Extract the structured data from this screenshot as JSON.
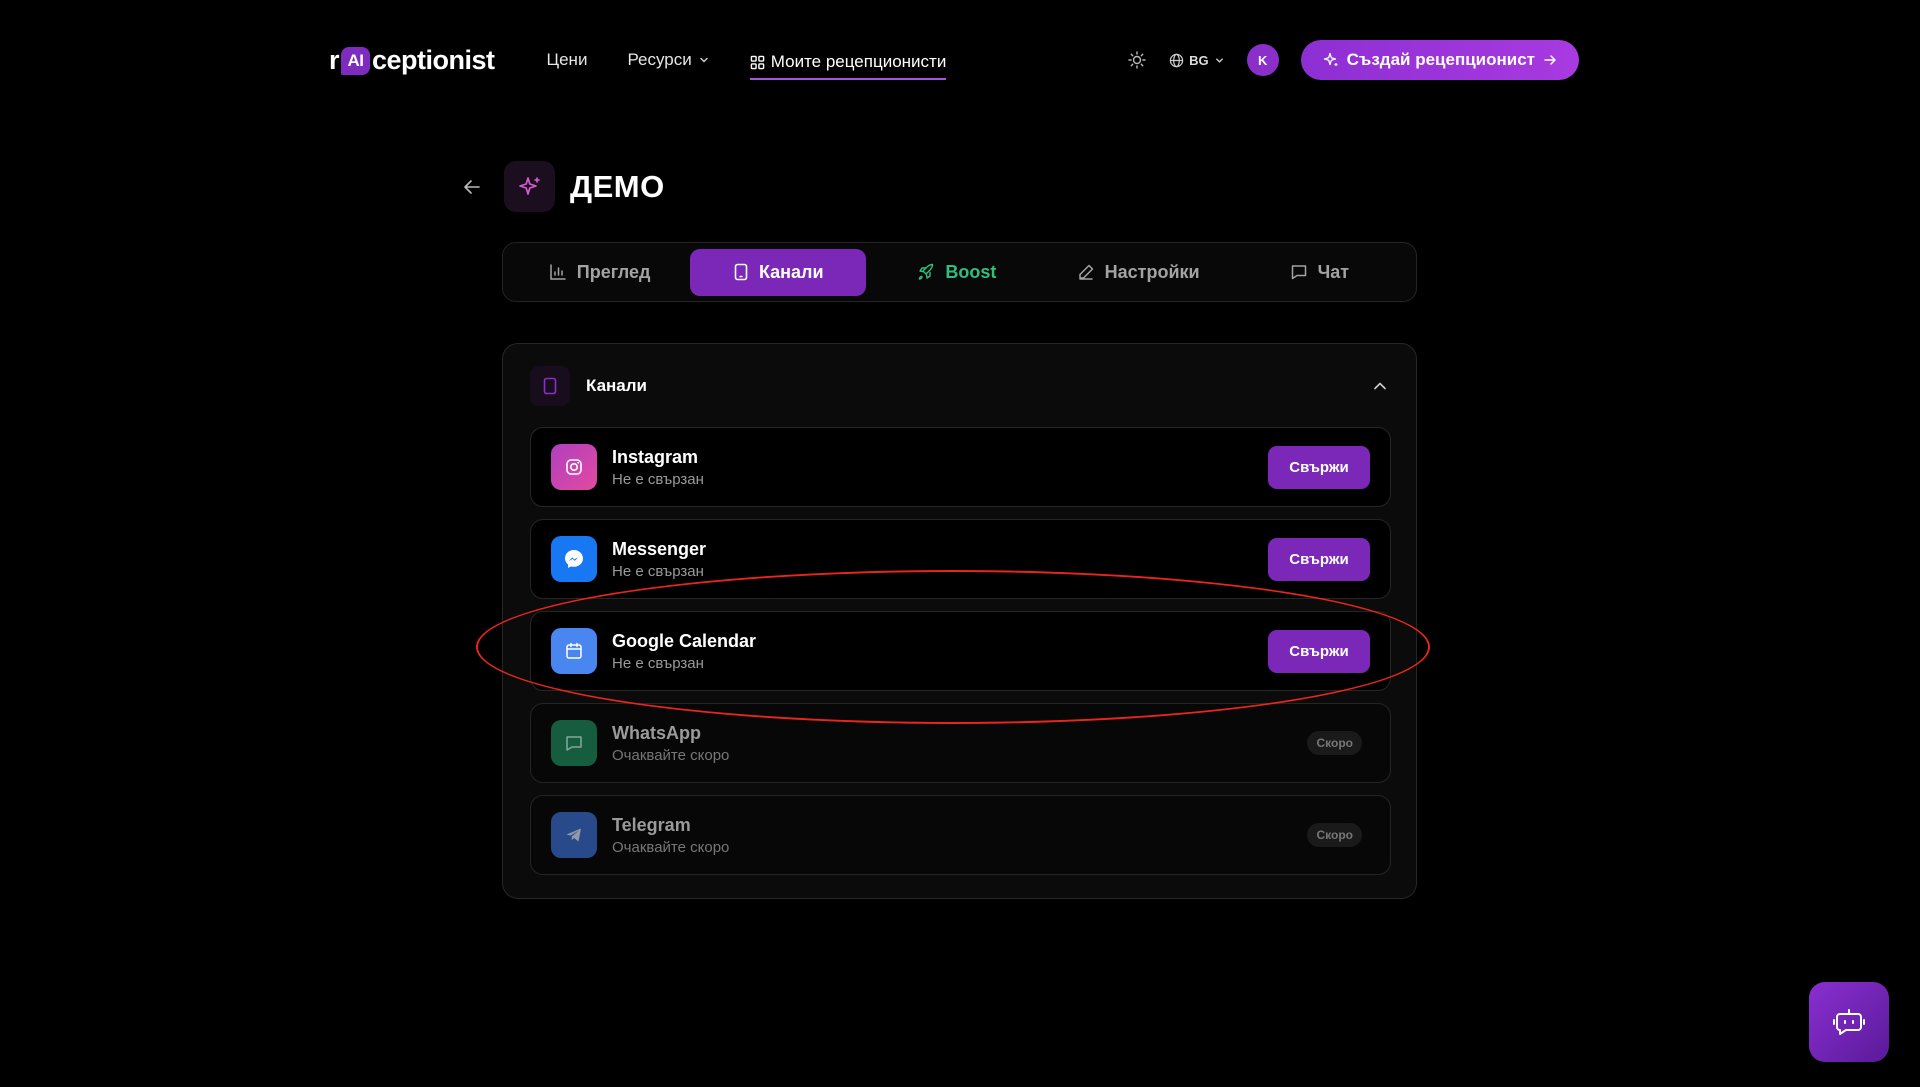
{
  "nav": {
    "logo_prefix": "r",
    "logo_ai": "AI",
    "logo_suffix": "ceptionist",
    "links": [
      {
        "label": "Цени"
      },
      {
        "label": "Ресурси"
      },
      {
        "label": "Моите рецепционисти"
      }
    ],
    "lang": "BG",
    "avatar_initial": "K",
    "create_label": "Създай рецепционист"
  },
  "page": {
    "title": "ДЕМО"
  },
  "tabs": [
    {
      "label": "Преглед",
      "icon": "bar-chart-icon"
    },
    {
      "label": "Канали",
      "icon": "tablet-icon",
      "active": true
    },
    {
      "label": "Boost",
      "icon": "rocket-icon"
    },
    {
      "label": "Настройки",
      "icon": "pencil-icon"
    },
    {
      "label": "Чат",
      "icon": "message-icon"
    }
  ],
  "card": {
    "title": "Канали"
  },
  "channels": [
    {
      "name": "Instagram",
      "status": "Не е свързан",
      "action": "Свържи",
      "icon": "instagram-icon",
      "color": "#c13584"
    },
    {
      "name": "Messenger",
      "status": "Не е свързан",
      "action": "Свържи",
      "icon": "messenger-icon",
      "color": "#1877f2"
    },
    {
      "name": "Google Calendar",
      "status": "Не е свързан",
      "action": "Свържи",
      "icon": "calendar-icon",
      "color": "#4a86f0"
    },
    {
      "name": "WhatsApp",
      "status": "Очаквайте скоро",
      "badge": "Скоро",
      "icon": "chat-icon",
      "color": "#1f6b4a"
    },
    {
      "name": "Telegram",
      "status": "Очаквайте скоро",
      "badge": "Скоро",
      "icon": "telegram-icon",
      "color": "#2d5aa8"
    }
  ],
  "colors": {
    "accent": "#7b28b9",
    "boost": "#2fbf80",
    "annotation": "#e8261c"
  }
}
